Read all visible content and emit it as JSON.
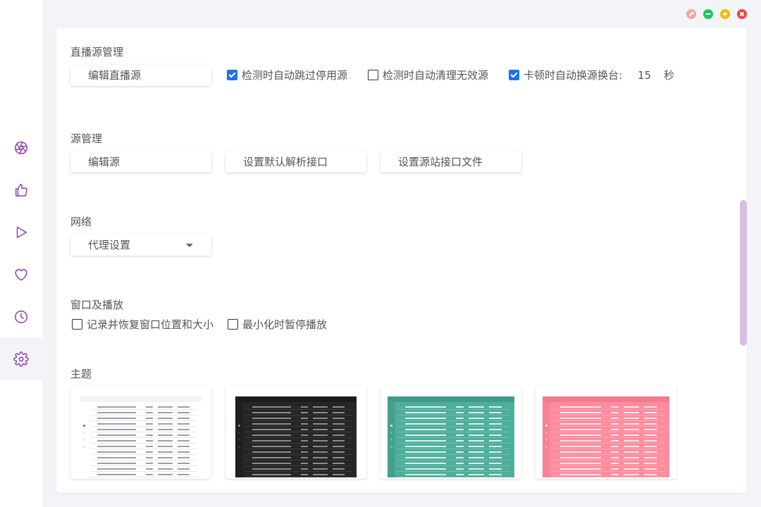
{
  "sidebar": {
    "items": [
      {
        "icon": "aperture-icon",
        "name": "live"
      },
      {
        "icon": "thumbs-up-icon",
        "name": "recommend"
      },
      {
        "icon": "play-icon",
        "name": "play"
      },
      {
        "icon": "heart-icon",
        "name": "favorites"
      },
      {
        "icon": "clock-icon",
        "name": "history"
      },
      {
        "icon": "gear-icon",
        "name": "settings",
        "active": true
      }
    ],
    "accent_color": "#8a3fb0"
  },
  "window_controls": {
    "pin_color": "#f4a6a6",
    "minimize_color": "#22c55e",
    "maximize_color": "#f5b800",
    "close_color": "#ef4444"
  },
  "live_source": {
    "title": "直播源管理",
    "edit_button": "编辑直播源",
    "skip_disabled_label": "检测时自动跳过停用源",
    "skip_disabled_checked": true,
    "clean_invalid_label": "检测时自动清理无效源",
    "clean_invalid_checked": false,
    "auto_switch_label": "卡顿时自动换源换台:",
    "auto_switch_checked": true,
    "seconds_value": "15",
    "seconds_unit": "秒"
  },
  "source": {
    "title": "源管理",
    "edit_button": "编辑源",
    "default_parser_button": "设置默认解析接口",
    "site_file_button": "设置源站接口文件"
  },
  "network": {
    "title": "网络",
    "proxy_select": "代理设置"
  },
  "window_play": {
    "title": "窗口及播放",
    "remember_window_label": "记录并恢复窗口位置和大小",
    "remember_window_checked": false,
    "pause_on_minimize_label": "最小化时暂停播放",
    "pause_on_minimize_checked": false
  },
  "theme": {
    "title": "主题",
    "options": [
      {
        "name": "light",
        "bg": "#ffffff",
        "bar": "#f3f3f3",
        "side": "#ffffff",
        "line": "#e6e6e6",
        "text": "#9aa0a6",
        "accent": "#8a3fb0"
      },
      {
        "name": "dark",
        "bg": "#262626",
        "bar": "#1c1c1c",
        "side": "#1f1f1f",
        "line": "#3a3a3a",
        "text": "#8c8c8c",
        "accent": "#22c55e"
      },
      {
        "name": "green",
        "bg": "#4fae9b",
        "bar": "#3f9a88",
        "side": "#459f8d",
        "line": "#6cc0ae",
        "text": "#d9f1ec",
        "accent": "#ffffff"
      },
      {
        "name": "pink",
        "bg": "#ff8c9e",
        "bar": "#f47a8e",
        "side": "#f78396",
        "line": "#ffa7b5",
        "text": "#ffe6ea",
        "accent": "#ffffff"
      }
    ]
  }
}
